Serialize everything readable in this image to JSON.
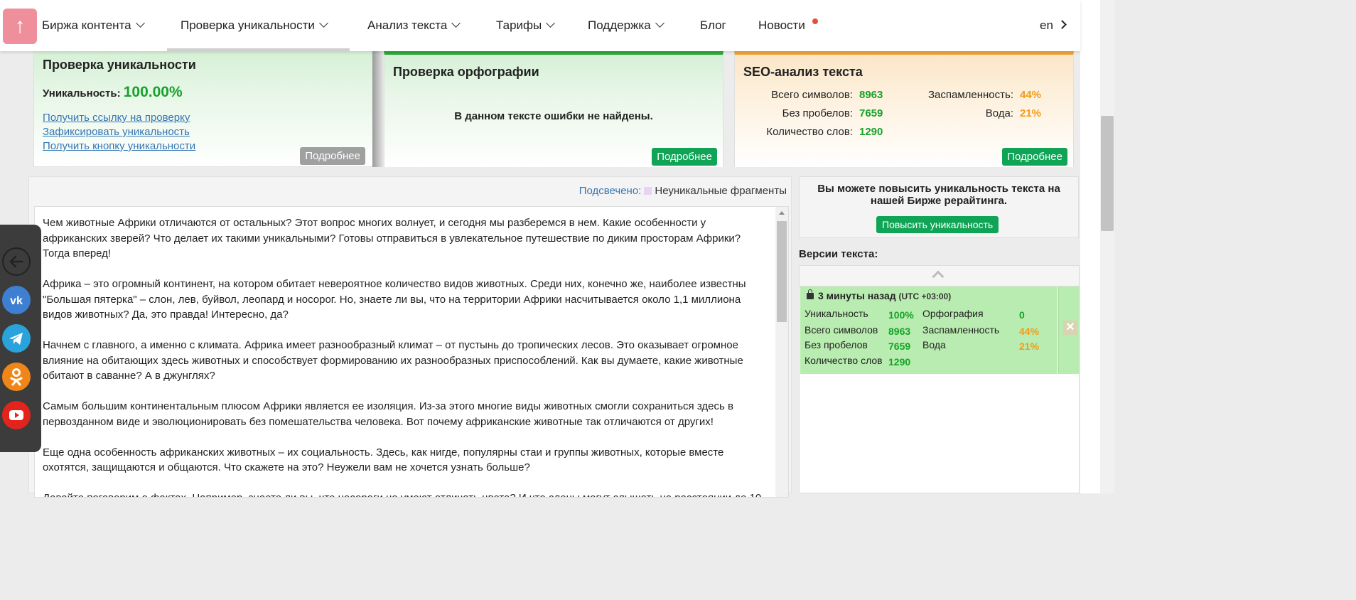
{
  "nav": {
    "items": [
      {
        "label": "Биржа контента"
      },
      {
        "label": "Проверка уникальности"
      },
      {
        "label": "Анализ текста"
      },
      {
        "label": "Тарифы"
      },
      {
        "label": "Поддержка"
      },
      {
        "label": "Блог"
      },
      {
        "label": "Новости"
      }
    ],
    "lang": "en",
    "logo_glyph": "↑"
  },
  "cards": {
    "uniqueness": {
      "title": "Проверка уникальности",
      "label": "Уникальность:",
      "value": "100.00%",
      "links": [
        "Получить ссылку на проверку",
        "Зафиксировать уникальность",
        "Получить кнопку уникальности"
      ],
      "more": "Подробнее"
    },
    "spelling": {
      "title": "Проверка орфографии",
      "message": "В данном тексте ошибки не найдены.",
      "more": "Подробнее"
    },
    "seo": {
      "title": "SEO-анализ текста",
      "total_label": "Всего символов:",
      "total_value": "8963",
      "nospace_label": "Без пробелов:",
      "nospace_value": "7659",
      "words_label": "Количество слов:",
      "words_value": "1290",
      "spam_label": "Заспамленность:",
      "spam_value": "44%",
      "water_label": "Вода:",
      "water_value": "21%",
      "more": "Подробнее"
    }
  },
  "highlight": {
    "label": "Подсвечено:",
    "legend": "Неуникальные фрагменты"
  },
  "text": {
    "paragraphs": [
      "Чем животные Африки отличаются от остальных? Этот вопрос многих волнует, и сегодня мы разберемся в нем. Какие особенности у африканских зверей? Что делает их такими уникальными? Готовы отправиться в увлекательное путешествие по диким просторам Африки? Тогда вперед!",
      "Африка – это огромный континент, на котором обитает невероятное количество видов животных. Среди них, конечно же, наиболее известны \"Большая пятерка\" – слон, лев, буйвол, леопард и носорог. Но, знаете ли вы, что на территории Африки насчитывается около 1,1 миллиона видов животных? Да, это правда! Интересно, да?",
      "Начнем с главного, а именно с климата. Африка имеет разнообразный климат – от пустынь до тропических лесов. Это оказывает огромное влияние на обитающих здесь животных и способствует формированию их разнообразных приспособлений. Как вы думаете, какие животные обитают в саванне? А в джунглях?",
      "Самым большим континентальным плюсом Африки является ее изоляция. Из-за этого многие виды животных смогли сохраниться здесь в первозданном виде и эволюционировать без помешательства человека. Вот почему африканские животные так отличаются от других!",
      "Еще одна особенность африканских животных – их социальность. Здесь, как нигде, популярны стаи и группы животных, которые вместе охотятся, защищаются и общаются. Что скажете на это? Неужели вам не хочется узнать больше?",
      "Давайте поговорим о фактах. Например, знаете ли вы, что носороги не умеют отличать цвета? И что слоны могут слышать на расстоянии до 10"
    ]
  },
  "promo": {
    "text": "Вы можете повысить уникальность текста на нашей Бирже рерайтинга.",
    "button": "Повысить уникальность"
  },
  "versions": {
    "title": "Версии текста:",
    "item": {
      "time": "3 минуты назад",
      "tz": "(UTC +03:00)",
      "uniq_label": "Уникальность",
      "uniq_value": "100%",
      "total_label": "Всего символов",
      "total_value": "8963",
      "nospace_label": "Без пробелов",
      "nospace_value": "7659",
      "words_label": "Количество слов",
      "words_value": "1290",
      "spell_label": "Орфография",
      "spell_value": "0",
      "spam_label": "Заспамленность",
      "spam_value": "44%",
      "water_label": "Вода",
      "water_value": "21%",
      "delete_glyph": "✕"
    }
  },
  "social": {
    "vk": "vk",
    "telegram": "telegram",
    "ok": "ok",
    "youtube": "youtube"
  },
  "colors": {
    "accent_green": "#10a457",
    "value_green": "#16a22a",
    "value_orange": "#f39a18",
    "link_blue": "#3576b3"
  }
}
